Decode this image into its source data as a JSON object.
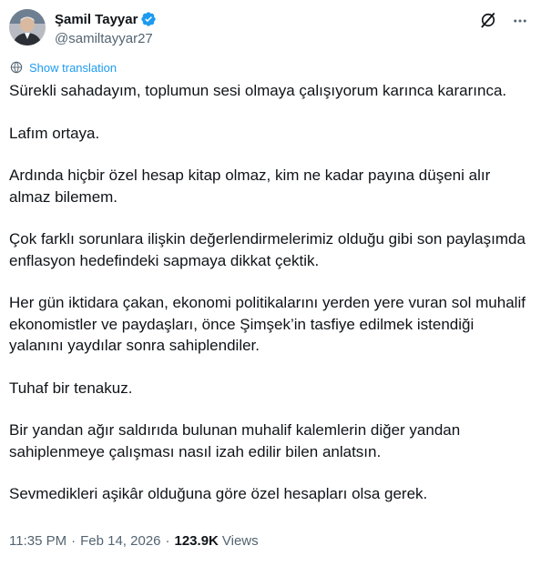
{
  "author": {
    "display_name": "Şamil Tayyar",
    "handle": "@samiltayyar27",
    "verified": true,
    "accent_color": "#1d9bf0"
  },
  "actions": {
    "grok_icon": "grok-icon",
    "more_icon": "more-icon"
  },
  "translate": {
    "label": "Show translation",
    "icon": "globe-translate-icon"
  },
  "tweet": {
    "paragraphs": [
      "Sürekli sahadayım, toplumun sesi olmaya çalışıyorum karınca kararınca.",
      "Lafım ortaya.",
      "Ardında hiçbir özel hesap kitap olmaz, kim ne kadar payına düşeni alır almaz bilemem.",
      "Çok farklı sorunlara ilişkin değerlendirmelerimiz olduğu gibi son paylaşımda enflasyon hedefindeki sapmaya dikkat çektik.",
      "Her gün iktidara çakan, ekonomi politikalarını yerden yere vuran sol muhalif ekonomistler ve paydaşları, önce Şimşek’in tasfiye edilmek istendiği yalanını yaydılar sonra sahiplendiler.",
      "Tuhaf bir tenakuz.",
      "Bir yandan ağır saldırıda bulunan muhalif kalemlerin diğer yandan sahiplenmeye çalışması nasıl izah edilir bilen anlatsın.",
      "Sevmedikleri aşikâr olduğuna göre özel hesapları olsa gerek."
    ]
  },
  "meta": {
    "time": "11:35 PM",
    "separator": "·",
    "date": "Feb 14, 2026",
    "views_count": "123.9K",
    "views_label": "Views"
  }
}
